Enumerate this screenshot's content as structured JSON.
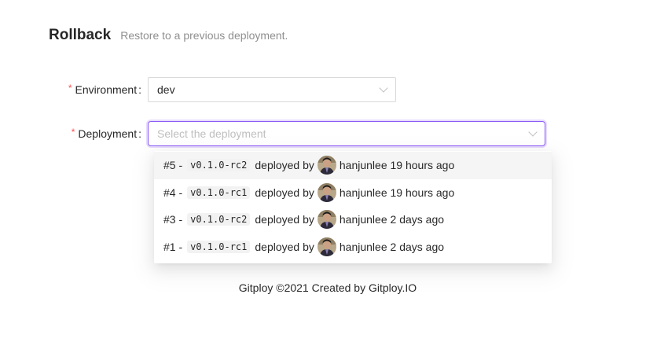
{
  "header": {
    "title": "Rollback",
    "subtitle": "Restore to a previous deployment."
  },
  "form": {
    "environment": {
      "required_mark": "*",
      "label": "Environment",
      "colon": ":",
      "value": "dev"
    },
    "deployment": {
      "required_mark": "*",
      "label": "Deployment",
      "colon": ":",
      "placeholder": "Select the deployment"
    }
  },
  "deployments": [
    {
      "number": "#5 -",
      "ref": "v0.1.0-rc2",
      "deployed_by": "deployed by",
      "user": "hanjunlee",
      "time": "19 hours ago",
      "active": true
    },
    {
      "number": "#4 -",
      "ref": "v0.1.0-rc1",
      "deployed_by": "deployed by",
      "user": "hanjunlee",
      "time": "19 hours ago",
      "active": false
    },
    {
      "number": "#3 -",
      "ref": "v0.1.0-rc2",
      "deployed_by": "deployed by",
      "user": "hanjunlee",
      "time": "2 days ago",
      "active": false
    },
    {
      "number": "#1 -",
      "ref": "v0.1.0-rc1",
      "deployed_by": "deployed by",
      "user": "hanjunlee",
      "time": "2 days ago",
      "active": false
    }
  ],
  "footer": {
    "text": "Gitploy ©2021 Created by Gitploy.IO"
  },
  "colors": {
    "focus_border": "#8b5cf6",
    "required": "#ff4d4f",
    "option_hover": "#f5f5f5"
  },
  "icons": {
    "select_arrow": "chevron-down-icon",
    "avatar": "user-avatar"
  }
}
